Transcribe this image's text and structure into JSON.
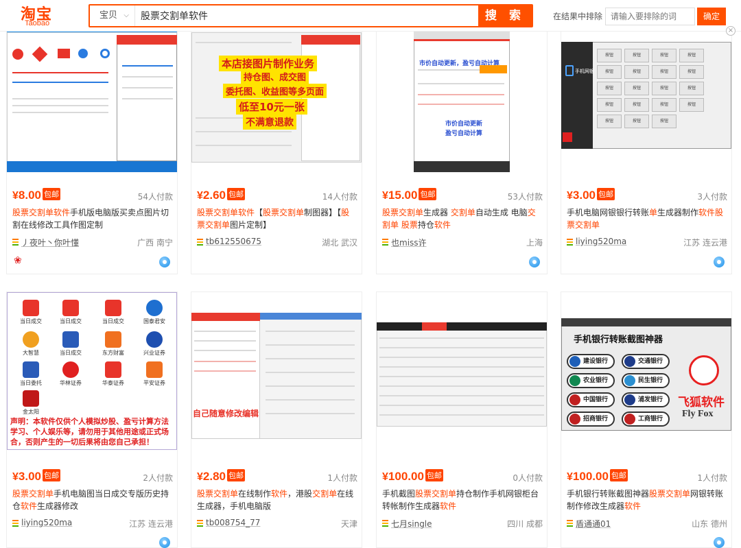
{
  "header": {
    "logo_zh": "淘宝",
    "logo_en": "Taobao",
    "category": "宝贝",
    "search_value": "股票交割单软件",
    "search_button": "搜 索",
    "exclude_label": "在结果中排除",
    "exclude_placeholder": "请输入要排除的词",
    "exclude_button": "确定"
  },
  "colors": {
    "accent": "#ff5000",
    "price": "#ff4400",
    "highlight": "#ff4400"
  },
  "thumb_texts": {
    "t2_lines": [
      "本店接图片制作业务",
      "持仓图、成交图",
      "委托图、收益图等多页面",
      "低至10元一张",
      "不满意退款"
    ],
    "t3_lines": [
      "市价自动更新，盈亏自动计算",
      "市价自动更新",
      "盈亏自动计算"
    ],
    "t4_app": "手机网银",
    "t5_icons": [
      "当日成交",
      "当日成交",
      "当日成交",
      "国泰君安",
      "大智慧",
      "当日成交",
      "东方财富",
      "兴业证券",
      "当日委托",
      "华林证券",
      "华泰证券",
      "平安证券",
      "金太阳"
    ],
    "t5_notice": "声明：本软件仅供个人模拟炒股、盈亏计算方法学习、个人娱乐等，请勿用于其他用途或正式场合，否则产生的一切后果将由您自己承担！",
    "t6_caption": "自己随意修改编辑",
    "t8_title": "手机银行转账截图神器",
    "t8_banks": [
      "建设银行",
      "交通银行",
      "农业银行",
      "民生银行",
      "中国银行",
      "浦发银行",
      "招商银行",
      "工商银行"
    ],
    "t8_brand_zh": "飞狐软件",
    "t8_brand_en": "Fly Fox"
  },
  "products": [
    {
      "price": "8.00",
      "baoyou": "包邮",
      "paid": "54人付款",
      "title_parts": [
        [
          "股票交割单软件",
          true
        ],
        [
          "手机版电脑版买卖点图片切割在线修改工具作图定制",
          false
        ]
      ],
      "shop": "丿夜叶丶你叶懂",
      "location": "广西 南宁"
    },
    {
      "price": "2.60",
      "baoyou": "包邮",
      "paid": "14人付款",
      "title_parts": [
        [
          "股票交割单软件",
          true
        ],
        [
          "【",
          false
        ],
        [
          "股票交割单",
          true
        ],
        [
          "制图器】【",
          false
        ],
        [
          "股票交割单",
          true
        ],
        [
          "图片定制】",
          false
        ]
      ],
      "shop": "tb612550675",
      "location": "湖北 武汉"
    },
    {
      "price": "15.00",
      "baoyou": "包邮",
      "paid": "53人付款",
      "title_parts": [
        [
          "股票交割单",
          true
        ],
        [
          "生成器 ",
          false
        ],
        [
          "交割单",
          true
        ],
        [
          "自动生成 电脑",
          false
        ],
        [
          "交割单",
          true
        ],
        [
          " ",
          false
        ],
        [
          "股票",
          true
        ],
        [
          "持仓",
          false
        ],
        [
          "软件",
          true
        ]
      ],
      "shop": "也miss许",
      "location": "上海"
    },
    {
      "price": "3.00",
      "baoyou": "包邮",
      "paid": "3人付款",
      "title_parts": [
        [
          "手机电脑网银银行转账",
          false
        ],
        [
          "单",
          true
        ],
        [
          "生成器制作",
          false
        ],
        [
          "软件股票交割单",
          true
        ]
      ],
      "shop": "liying520ma",
      "location": "江苏 连云港"
    },
    {
      "price": "3.00",
      "baoyou": "包邮",
      "paid": "2人付款",
      "title_parts": [
        [
          "股票交割单",
          true
        ],
        [
          "手机电脑图当日成交专版历史持仓",
          false
        ],
        [
          "软件",
          true
        ],
        [
          "生成器修改",
          false
        ]
      ],
      "shop": "liying520ma",
      "location": "江苏 连云港"
    },
    {
      "price": "2.80",
      "baoyou": "包邮",
      "paid": "1人付款",
      "title_parts": [
        [
          "股票交割单",
          true
        ],
        [
          "在线制作",
          false
        ],
        [
          "软件",
          true
        ],
        [
          "，港股",
          false
        ],
        [
          "交割单",
          true
        ],
        [
          "在线生成器，手机电脑版",
          false
        ]
      ],
      "shop": "tb008754_77",
      "location": "天津"
    },
    {
      "price": "100.00",
      "baoyou": "包邮",
      "paid": "0人付款",
      "title_parts": [
        [
          "手机截图",
          false
        ],
        [
          "股票交割单",
          true
        ],
        [
          "持仓制作手机网银柜台转帐制作生成器",
          false
        ],
        [
          "软件",
          true
        ]
      ],
      "shop": "七月single",
      "location": "四川 成都"
    },
    {
      "price": "100.00",
      "baoyou": "包邮",
      "paid": "1人付款",
      "title_parts": [
        [
          "手机银行转账截图神器",
          false
        ],
        [
          "股票交割单",
          true
        ],
        [
          "网银转账制作修改生成器",
          false
        ],
        [
          "软件",
          true
        ]
      ],
      "shop": "盾通通01",
      "location": "山东 德州"
    }
  ]
}
